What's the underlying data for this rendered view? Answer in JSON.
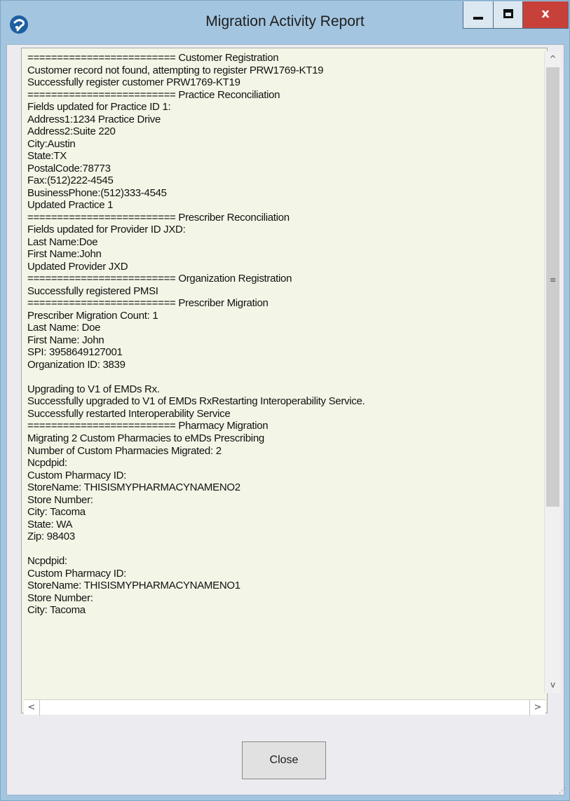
{
  "window": {
    "title": "Migration Activity Report"
  },
  "icons": {
    "app": "app-logo-icon",
    "minimize": "minimize-icon",
    "maximize": "maximize-icon",
    "close": "close-icon"
  },
  "caption": {
    "close_label": "x"
  },
  "log": {
    "lines": [
      "========================= Customer Registration",
      "Customer record not found, attempting to register PRW1769-KT19",
      "Successfully register customer PRW1769-KT19",
      "========================= Practice Reconciliation",
      "Fields updated for Practice ID 1:",
      "Address1:1234 Practice Drive",
      "Address2:Suite 220",
      "City:Austin",
      "State:TX",
      "PostalCode:78773",
      "Fax:(512)222-4545",
      "BusinessPhone:(512)333-4545",
      "Updated Practice 1",
      "========================= Prescriber Reconciliation",
      "Fields updated for Provider ID JXD:",
      "Last Name:Doe",
      "First Name:John",
      "Updated Provider JXD",
      "========================= Organization Registration",
      "Successfully registered PMSI",
      "========================= Prescriber Migration",
      "Prescriber Migration Count: 1",
      "Last Name: Doe",
      "First Name: John",
      "SPI: 3958649127001",
      "Organization ID: 3839",
      "",
      "Upgrading to V1 of EMDs Rx.",
      "Successfully upgraded to V1 of EMDs RxRestarting Interoperability Service.",
      "Successfully restarted Interoperability Service",
      "========================= Pharmacy Migration",
      "Migrating 2 Custom Pharmacies to eMDs Prescribing",
      "Number of Custom Pharmacies Migrated: 2",
      "Ncpdpid:",
      "Custom Pharmacy ID:",
      "StoreName: THISISMYPHARMACYNAMENO2",
      "Store Number:",
      "City: Tacoma",
      "State: WA",
      "Zip: 98403",
      "",
      "Ncpdpid:",
      "Custom Pharmacy ID:",
      "StoreName: THISISMYPHARMACYNAMENO1",
      "Store Number:",
      "City: Tacoma"
    ]
  },
  "scrollbars": {
    "up_glyph": "^",
    "down_glyph": "v",
    "left_glyph": "<",
    "right_glyph": ">",
    "grip_glyph": "≡"
  },
  "footer": {
    "close_button_label": "Close"
  },
  "colors": {
    "window_bg": "#a3c5e0",
    "log_bg": "#f3f6e6",
    "close_caption_bg": "#c7403a"
  }
}
